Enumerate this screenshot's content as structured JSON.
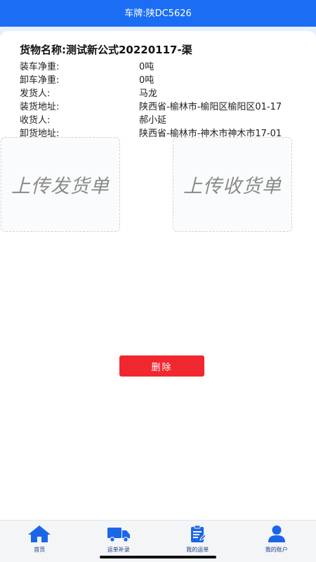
{
  "header": {
    "title": "车牌:陕DC5626"
  },
  "cargo": {
    "title": "货物名称:测试新公式20220117-渠"
  },
  "info": [
    {
      "label": "装车净重:",
      "value": "0吨"
    },
    {
      "label": "卸车净重:",
      "value": "0吨"
    },
    {
      "label": "发货人:",
      "value": "马龙"
    },
    {
      "label": "装货地址:",
      "value": "陕西省-榆林市-榆阳区榆阳区01-17"
    },
    {
      "label": "收货人:",
      "value": "郝小延"
    },
    {
      "label": "卸货地址:",
      "value": "陕西省-榆林市-神木市神木市17-01"
    }
  ],
  "upload": {
    "send": "上传发货单",
    "receive": "上传收货单"
  },
  "actions": {
    "delete": "删除"
  },
  "tabbar": [
    {
      "label": "首页",
      "icon": "home-icon"
    },
    {
      "label": "运单补录",
      "icon": "truck-icon"
    },
    {
      "label": "我的运单",
      "icon": "clipboard-icon"
    },
    {
      "label": "我的账户",
      "icon": "user-icon"
    }
  ],
  "colors": {
    "brand": "#1b6ef3",
    "danger": "#f0272f",
    "icon": "#1b66e8"
  }
}
